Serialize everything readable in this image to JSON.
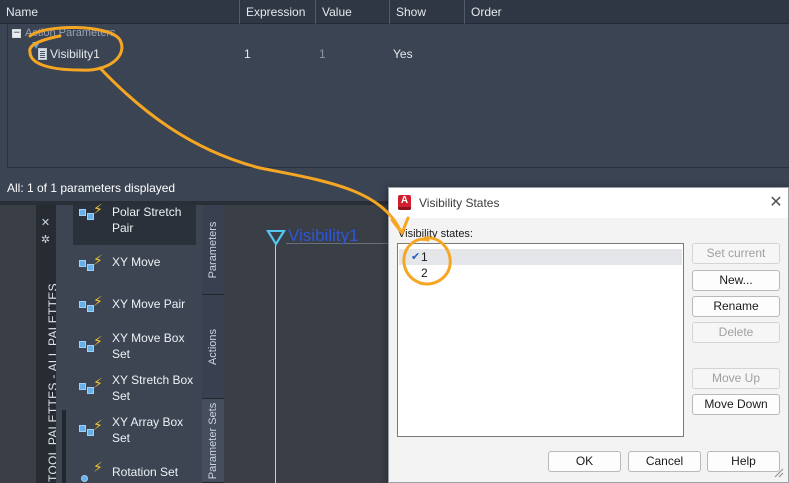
{
  "parameter_manager": {
    "columns": [
      "Name",
      "Expression",
      "Value",
      "Show",
      "Order"
    ],
    "group_label": "Action Parameters",
    "group_toggle": "−",
    "rows": [
      {
        "name": "Visibility1",
        "expression": "1",
        "value": "1",
        "show": "Yes",
        "order": ""
      }
    ],
    "footer": "All: 1 of 1 parameters displayed"
  },
  "palette": {
    "title": "TOOL PALETTES - ALL PALETTES",
    "side_icons": [
      "pin-icon",
      "properties-icon"
    ],
    "tabs": [
      "Parameters",
      "Actions",
      "Parameter Sets"
    ],
    "tools": [
      {
        "label": "Polar Stretch Pair",
        "icon": "polar-stretch-pair-icon"
      },
      {
        "label": "XY Move",
        "icon": "xy-move-icon"
      },
      {
        "label": "XY Move Pair",
        "icon": "xy-move-pair-icon"
      },
      {
        "label": "XY Move Box Set",
        "icon": "xy-move-box-set-icon"
      },
      {
        "label": "XY Stretch Box Set",
        "icon": "xy-stretch-box-set-icon"
      },
      {
        "label": "XY Array Box Set",
        "icon": "xy-array-box-set-icon"
      },
      {
        "label": "Rotation Set",
        "icon": "rotation-set-icon"
      }
    ]
  },
  "drawing": {
    "parameter_label": "Visibility1",
    "parameter_color": "#2f56d6",
    "grip_color": "#56c7f0"
  },
  "dialog": {
    "title": "Visibility States",
    "close_glyph": "✕",
    "list_label": "Visibility states:",
    "states": [
      {
        "name": "1",
        "current": true
      },
      {
        "name": "2",
        "current": false
      }
    ],
    "check_glyph": "✔",
    "side_buttons": {
      "set_current": "Set current",
      "new": "New...",
      "rename": "Rename",
      "delete": "Delete",
      "move_up": "Move Up",
      "move_down": "Move Down"
    },
    "footer_buttons": {
      "ok": "OK",
      "cancel": "Cancel",
      "help": "Help"
    }
  },
  "annotation_color": "#f5a623"
}
